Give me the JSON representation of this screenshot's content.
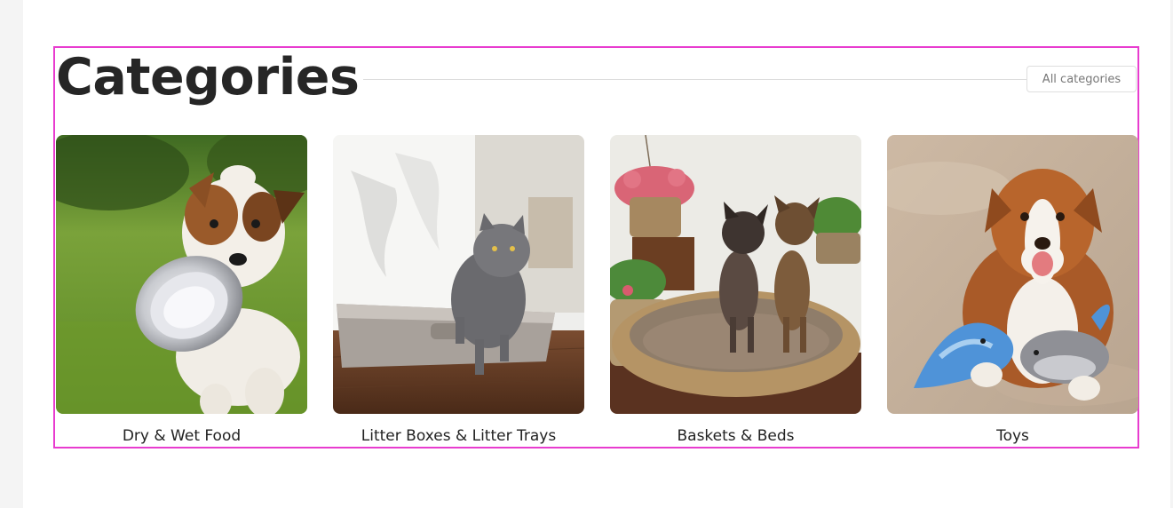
{
  "section": {
    "title": "Categories",
    "all_button": "All categories"
  },
  "categories": [
    {
      "label": "Dry & Wet Food",
      "image": "dog-with-food-bowl-photo"
    },
    {
      "label": "Litter Boxes & Litter Trays",
      "image": "cat-in-litter-box-photo"
    },
    {
      "label": "Baskets & Beds",
      "image": "dogs-in-wicker-basket-photo"
    },
    {
      "label": "Toys",
      "image": "dog-with-plush-toys-photo"
    }
  ],
  "colors": {
    "highlight_border": "#e83ccf",
    "title_text": "#262626",
    "label_text": "#222222"
  }
}
